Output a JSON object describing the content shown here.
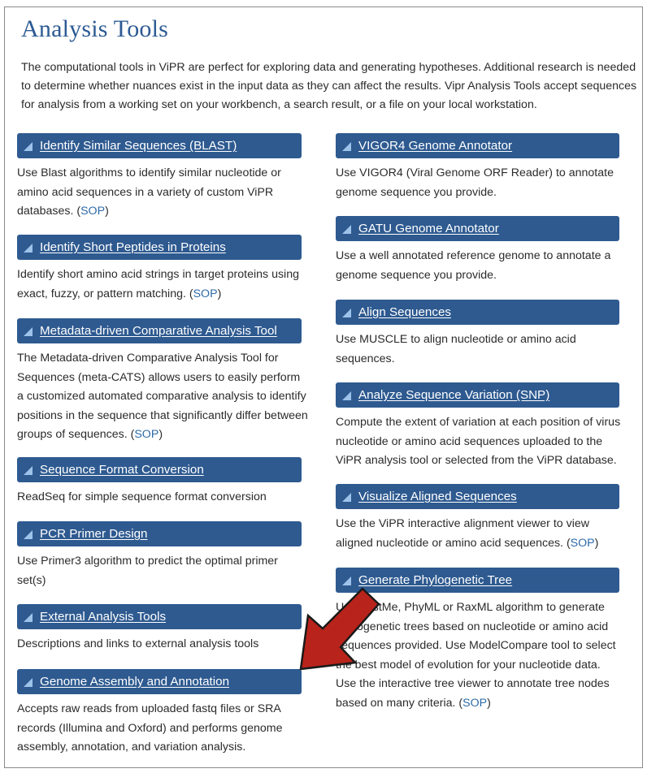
{
  "page": {
    "title": "Analysis Tools",
    "intro": "The computational tools in ViPR are perfect for exploring data and generating hypotheses. Additional research is needed to determine whether nuances exist in the input data as they can affect the results. Vipr Analysis Tools accept sequences for analysis from a working set on your workbench, a search result, or a file on your local workstation."
  },
  "colors": {
    "header_bg": "#2e5a90",
    "title": "#2c5a93",
    "sop_link": "#2c6aa8",
    "arrow": "#b8231b"
  },
  "left_tools": [
    {
      "title": "Identify Similar Sequences (BLAST)",
      "desc": "Use Blast algorithms to identify similar nucleotide or amino acid sequences in a variety of custom ViPR databases.",
      "sop": "SOP"
    },
    {
      "title": "Identify Short Peptides in Proteins",
      "desc": "Identify short amino acid strings in target proteins using exact, fuzzy, or pattern matching.",
      "sop": "SOP"
    },
    {
      "title": "Metadata-driven Comparative Analysis Tool",
      "desc": "The Metadata-driven Comparative Analysis Tool for Sequences (meta-CATS) allows users to easily perform a customized automated comparative analysis to identify positions in the sequence that significantly differ between groups of sequences.",
      "sop": "SOP"
    },
    {
      "title": "Sequence Format Conversion",
      "desc": "ReadSeq for simple sequence format conversion"
    },
    {
      "title": "PCR Primer Design",
      "desc": "Use Primer3 algorithm to predict the optimal primer set(s)"
    },
    {
      "title": "External Analysis Tools",
      "desc": "Descriptions and links to external analysis tools"
    },
    {
      "title": "Genome Assembly and Annotation",
      "desc": "Accepts raw reads from uploaded fastq files or SRA records (Illumina and Oxford) and performs genome assembly, annotation, and variation analysis."
    }
  ],
  "right_tools": [
    {
      "title": "VIGOR4 Genome Annotator",
      "desc": "Use VIGOR4 (Viral Genome ORF Reader) to annotate genome sequence you provide."
    },
    {
      "title": "GATU Genome Annotator",
      "desc": "Use a well annotated reference genome to annotate a genome sequence you provide."
    },
    {
      "title": "Align Sequences",
      "desc": "Use MUSCLE to align nucleotide or amino acid sequences."
    },
    {
      "title": "Analyze Sequence Variation (SNP)",
      "desc": "Compute the extent of variation at each position of virus nucleotide or amino acid sequences uploaded to the ViPR analysis tool or selected from the ViPR database."
    },
    {
      "title": "Visualize Aligned Sequences",
      "desc": "Use the ViPR interactive alignment viewer to view aligned nucleotide or amino acid sequences.",
      "sop": "SOP"
    },
    {
      "title": "Generate Phylogenetic Tree",
      "desc": "Use FastMe, PhyML or RaxML algorithm to generate phylogenetic trees based on nucleotide or amino acid sequences provided. Use ModelCompare tool to select the best model of evolution for your nucleotide data. Use the interactive tree viewer to annotate tree nodes based on many criteria.",
      "sop": "SOP"
    }
  ]
}
